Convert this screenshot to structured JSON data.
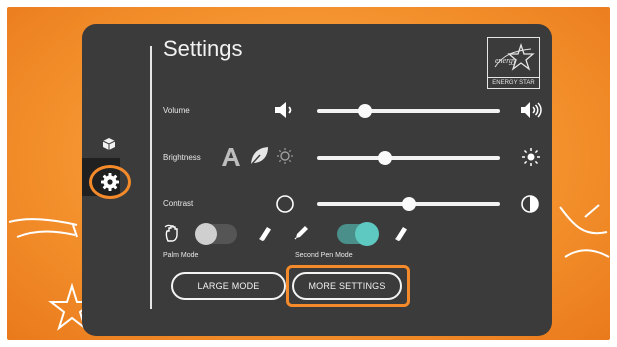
{
  "header": {
    "title": "Settings"
  },
  "energy_star": {
    "label": "ENERGY STAR",
    "script": "energy"
  },
  "sidebar": {
    "items": [
      {
        "icon": "cube-icon"
      },
      {
        "icon": "gear-icon",
        "selected": true
      }
    ]
  },
  "volume": {
    "label": "Volume",
    "level_percent": 26
  },
  "brightness": {
    "label": "Brightness",
    "level_percent": 37
  },
  "contrast": {
    "label": "Contrast",
    "level_percent": 50
  },
  "palm_mode": {
    "label": "Palm Mode",
    "on": false
  },
  "second_pen_mode": {
    "label": "Second Pen Mode",
    "on": true
  },
  "buttons": {
    "large_mode": "LARGE MODE",
    "more_settings": "MORE SETTINGS"
  },
  "colors": {
    "panel": "#3b3b3b",
    "accent": "#5ec9c0",
    "highlight": "#f58a2a",
    "background": "#f3902c"
  }
}
